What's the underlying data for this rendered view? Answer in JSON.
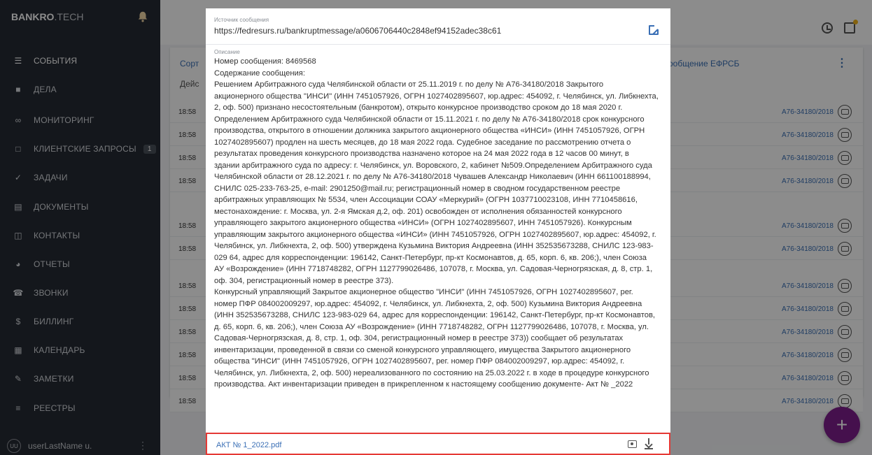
{
  "sidebar": {
    "brand_main": "BANKRO",
    "brand_suffix": ".TECH",
    "items": [
      {
        "label": "СОБЫТИЯ",
        "icon": "events-icon",
        "active": true
      },
      {
        "label": "ДЕЛА",
        "icon": "briefcase-icon"
      },
      {
        "label": "МОНИТОРИНГ",
        "icon": "binoculars-icon"
      },
      {
        "label": "КЛИЕНТСКИЕ ЗАПРОСЫ",
        "icon": "chat-icon",
        "badge": "1"
      },
      {
        "label": "ЗАДАЧИ",
        "icon": "clipboard-check-icon"
      },
      {
        "label": "ДОКУМЕНТЫ",
        "icon": "documents-icon"
      },
      {
        "label": "КОНТАКТЫ",
        "icon": "book-icon"
      },
      {
        "label": "ОТЧЕТЫ",
        "icon": "pie-chart-icon"
      },
      {
        "label": "ЗВОНКИ",
        "icon": "phone-icon"
      },
      {
        "label": "БИЛЛИНГ",
        "icon": "dollar-icon"
      },
      {
        "label": "КАЛЕНДАРЬ",
        "icon": "calendar-icon"
      },
      {
        "label": "ЗАМЕТКИ",
        "icon": "pencil-icon"
      },
      {
        "label": "РЕЕСТРЫ",
        "icon": "list-icon"
      }
    ],
    "user": {
      "initials": "UU",
      "name": "userLastName u."
    }
  },
  "background": {
    "head_left": "Сорт",
    "head_right": "ообщение ЕФРСБ",
    "sub_left": "Дейс",
    "rows": [
      {
        "time": "18:58",
        "case": "А76-34180/2018"
      },
      {
        "time": "18:58",
        "case": "А76-34180/2018"
      },
      {
        "time": "18:58",
        "case": "А76-34180/2018"
      },
      {
        "time": "18:58",
        "case": "А76-34180/2018"
      },
      {
        "time": "18:58",
        "case": "А76-34180/2018"
      },
      {
        "time": "18:58",
        "case": "А76-34180/2018"
      },
      {
        "time": "18:58",
        "case": "А76-34180/2018"
      },
      {
        "time": "18:58",
        "case": "А76-34180/2018"
      },
      {
        "time": "18:58",
        "case": "А76-34180/2018"
      },
      {
        "time": "18:58",
        "case": "А76-34180/2018"
      },
      {
        "time": "18:58",
        "case": "А76-34180/2018"
      },
      {
        "time": "18:58",
        "case": "А76-34180/2018"
      }
    ]
  },
  "modal": {
    "source_label": "Источник сообщения",
    "source_url": "https://fedresurs.ru/bankruptmessage/a0606706440c2848ef94152adec38c61",
    "description_label": "Описание",
    "description_lines": [
      "Номер сообщения: 8469568",
      "Содержание сообщения:",
      "Решением Арбитражного суда Челябинской области от 25.11.2019 г. по делу № А76-34180/2018 Закрытого",
      "акционерного общества \"ИНСИ\" (ИНН 7451057926, ОГРН 1027402895607, юр.адрес: 454092, г. Челябинск, ул. Либкнехта,",
      "2, оф. 500) признано несостоятельным (банкротом), открыто конкурсное производство сроком до 18 мая 2020 г.",
      "Определением Арбитражного суда Челябинской области от 15.11.2021 г. по делу № А76-34180/2018 срок конкурсного",
      "производства, открытого в отношении должника закрытого акционерного общества «ИНСИ» (ИНН 7451057926, ОГРН",
      "1027402895607) продлен на шесть месяцев, до 18 мая 2022 года. Судебное заседание по рассмотрению отчета о",
      "результатах проведения конкурсного производства назначено которое на 24 мая 2022 года в 12 часов 00 минут, в",
      "здании арбитражного суда по адресу: г. Челябинск, ул. Воровского, 2, кабинет №509.Определением Арбитражного суда",
      "Челябинской области от 28.12.2021 г. по делу № А76-34180/2018 Чувашев Александр Николаевич (ИНН 661100188994,",
      "СНИЛС 025-233-763-25, e-mail: 2901250@mail.ru; регистрационный номер в сводном государственном реестре",
      "арбитражных управляющих № 5534, член Ассоциации СОАУ «Меркурий» (ОГРН 1037710023108, ИНН 7710458616,",
      "местонахождение: г. Москва, ул. 2-я Ямская д.2, оф. 201) освобожден от исполнения обязанностей конкурсного",
      "управляющего закрытого акционерного общества «ИНСИ» (ОГРН 1027402895607, ИНН 7451057926). Конкурсным",
      "управляющим закрытого акционерного общества «ИНСИ» (ИНН 7451057926, ОГРН 1027402895607, юр.адрес: 454092, г.",
      "Челябинск, ул. Либкнехта, 2, оф. 500) утверждена Кузьмина Виктория Андреевна (ИНН 352535673288, СНИЛС 123-983-",
      "029 64, адрес для корреспонденции: 196142, Санкт-Петербург, пр-кт Космонавтов, д. 65, корп. 6, кв. 206;), член Союза",
      "АУ «Возрождение» (ИНН 7718748282, ОГРН 1127799026486, 107078, г. Москва, ул. Садовая-Черногрязская, д. 8, стр. 1,",
      "оф. 304, регистрационный номер в реестре 373).",
      "Конкурсный управляющий Закрытое акционерное общество \"ИНСИ\" (ИНН 7451057926, ОГРН 1027402895607, рег.",
      "номер ПФР 084002009297, юр.адрес: 454092, г. Челябинск, ул. Либкнехта, 2, оф. 500) Кузьмина Виктория Андреевна",
      "(ИНН 352535673288, СНИЛС 123-983-029 64, адрес для корреспонденции: 196142, Санкт-Петербург, пр-кт Космонавтов,",
      "д. 65, корп. 6, кв. 206;), член Союза АУ «Возрождение» (ИНН 7718748282, ОГРН 1127799026486, 107078, г. Москва, ул.",
      "Садовая-Черногрязская, д. 8, стр. 1, оф. 304, регистрационный номер в реестре 373)) сообщает об результатах",
      "инвентаризации, проведенной в связи со сменой конкурсного управляющего, имущества Закрытого акционерного",
      "общества \"ИНСИ\" (ИНН 7451057926, ОГРН 1027402895607, рег. номер ПФР 084002009297, юр.адрес: 454092, г.",
      "Челябинск, ул. Либкнехта, 2, оф. 500) нереализованного по состоянию на 25.03.2022 г. в ходе в процедуре конкурсного",
      "производства. Акт инвентаризации приведен в прикрепленном к настоящему сообщению документе- Акт № _2022"
    ],
    "attachment": {
      "filename": "АКТ № 1_2022.pdf"
    }
  },
  "fab_label": "+",
  "colors": {
    "accent": "#3a6fb5",
    "sidebar_bg": "#262b33",
    "fab": "#7e1e8c",
    "highlight": "#e53935"
  }
}
